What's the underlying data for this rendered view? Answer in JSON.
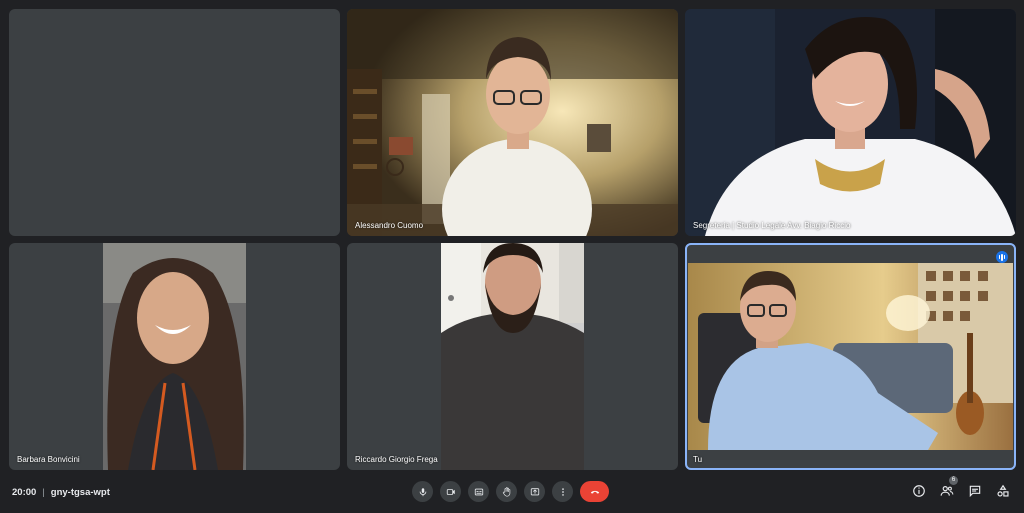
{
  "participants": [
    {
      "name": ""
    },
    {
      "name": "Alessandro Cuomo"
    },
    {
      "name": "Segreteria | Studio Legale Avv. Biagio Riccio"
    },
    {
      "name": "Barbara Bonvicini"
    },
    {
      "name": "Riccardo Giorgio Frega"
    },
    {
      "name": "Tu"
    }
  ],
  "meeting": {
    "time": "20:00",
    "separator": "|",
    "code": "gny-tgsa-wpt"
  },
  "people_count": "6",
  "colors": {
    "tile": "#3c4043",
    "background": "#202124",
    "end_call": "#ea4335",
    "active_outline": "#8ab4f8",
    "speaking_badge": "#1a73e8"
  },
  "icons": {
    "controls": [
      "microphone-icon",
      "camera-icon",
      "captions-icon",
      "raise-hand-icon",
      "present-screen-icon",
      "more-options-icon",
      "end-call-icon"
    ],
    "right": [
      "info-icon",
      "people-icon",
      "chat-icon",
      "activities-icon"
    ]
  }
}
